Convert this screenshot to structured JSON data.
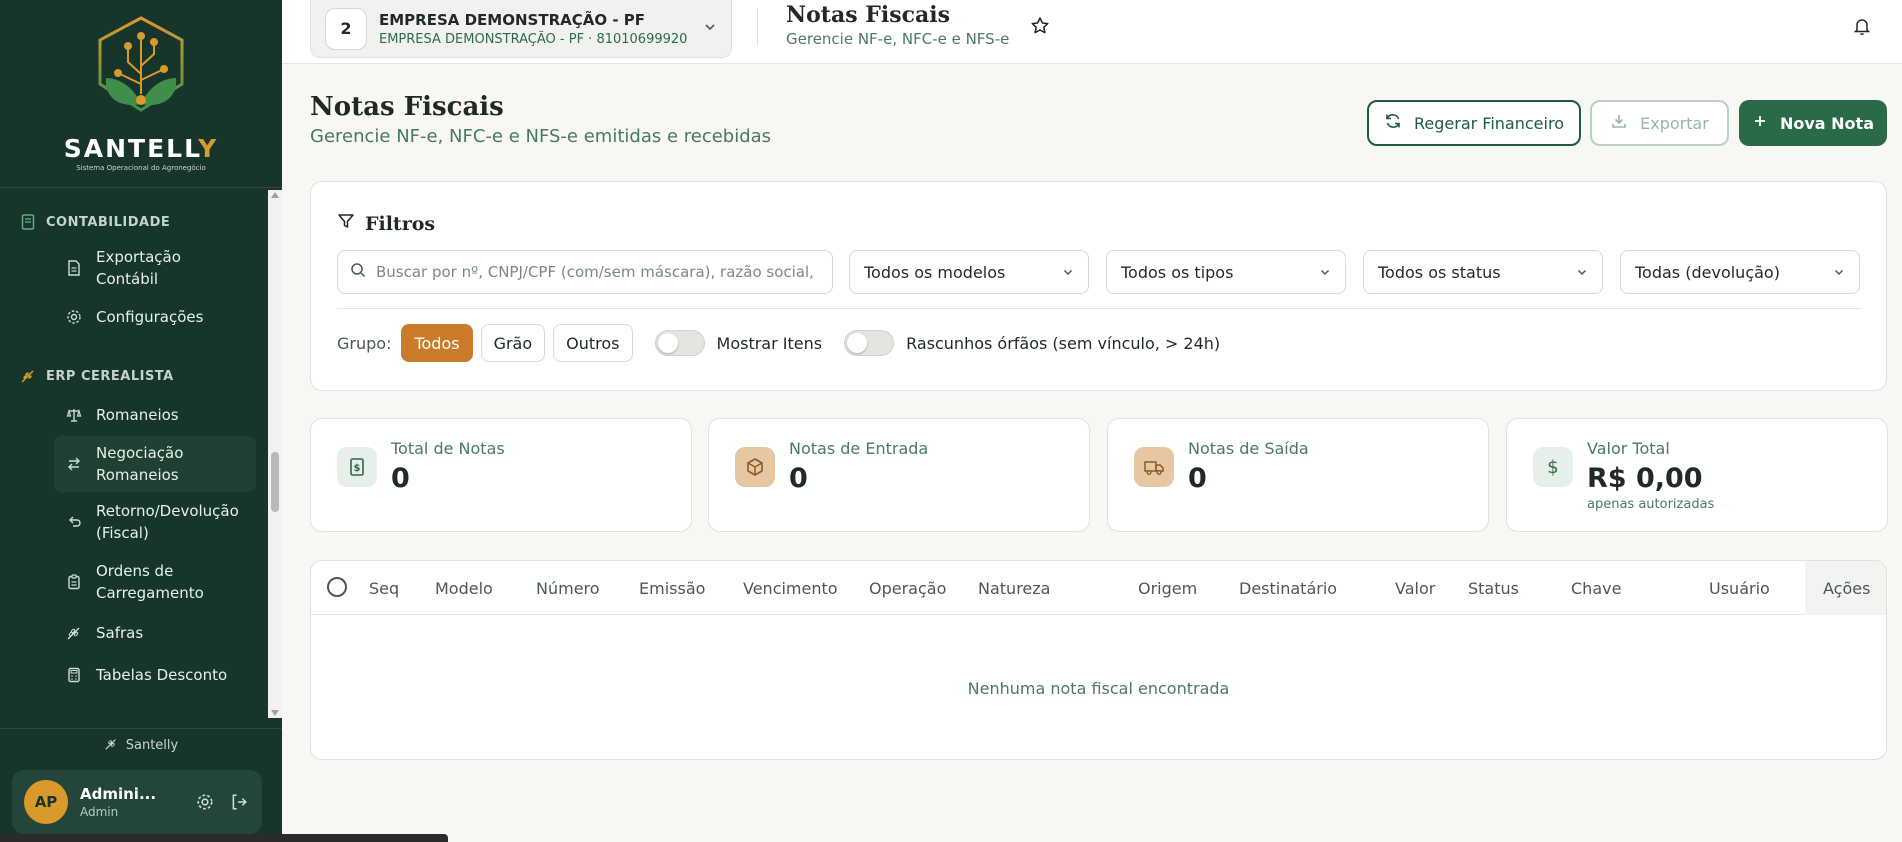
{
  "sidebar": {
    "brand": {
      "name_main": "SANTELL",
      "name_accent": "Y",
      "subtitle": "Sistema Operacional do Agronegócio"
    },
    "sections": [
      {
        "title": "CONTABILIDADE",
        "icon": "ledger-icon",
        "items": [
          {
            "label": "Exportação Contábil",
            "icon": "file-export-icon"
          },
          {
            "label": "Configurações",
            "icon": "gear-icon"
          }
        ]
      },
      {
        "title": "ERP CEREALISTA",
        "icon": "wheat-icon",
        "items": [
          {
            "label": "Romaneios",
            "icon": "scale-icon"
          },
          {
            "label": "Negociação Romaneios",
            "icon": "swap-icon",
            "active": true
          },
          {
            "label": "Retorno/Devolução (Fiscal)",
            "icon": "return-icon"
          },
          {
            "label": "Ordens de Carregamento",
            "icon": "clipboard-icon"
          },
          {
            "label": "Safras",
            "icon": "wheat-icon"
          },
          {
            "label": "Tabelas Desconto",
            "icon": "calculator-icon"
          }
        ]
      }
    ],
    "footer_label": "Santelly",
    "user": {
      "initials": "AP",
      "name": "Admini...",
      "role": "Admin"
    }
  },
  "topbar": {
    "company": {
      "code": "2",
      "name": "EMPRESA DEMONSTRAÇÃO - PF",
      "detail": "EMPRESA DEMONSTRAÇÃO - PF · 81010699920"
    },
    "title": "Notas Fiscais",
    "subtitle": "Gerencie NF-e, NFC-e e NFS-e"
  },
  "page": {
    "title": "Notas Fiscais",
    "subtitle": "Gerencie NF-e, NFC-e e NFS-e emitidas e recebidas",
    "buttons": {
      "regerar": "Regerar Financeiro",
      "exportar": "Exportar",
      "nova": "Nova Nota"
    }
  },
  "filters": {
    "title": "Filtros",
    "search_placeholder": "Buscar por nº, CNPJ/CPF (com/sem máscara), razão social, n",
    "selects": [
      "Todos os modelos",
      "Todos os tipos",
      "Todos os status",
      "Todas (devolução)"
    ],
    "group_label": "Grupo:",
    "groups": [
      "Todos",
      "Grão",
      "Outros"
    ],
    "active_group": "Todos",
    "toggles": [
      "Mostrar Itens",
      "Rascunhos órfãos (sem vínculo, > 24h)"
    ]
  },
  "stats": [
    {
      "label": "Total de Notas",
      "value": "0",
      "icon": "receipt-dollar-icon",
      "icon_bg": "#e6efe9",
      "icon_color": "#2b6a47"
    },
    {
      "label": "Notas de Entrada",
      "value": "0",
      "icon": "package-icon",
      "icon_bg": "#e7c7a2",
      "icon_color": "#8a5a24"
    },
    {
      "label": "Notas de Saída",
      "value": "0",
      "icon": "truck-icon",
      "icon_bg": "#e7c7a2",
      "icon_color": "#8a5a24"
    },
    {
      "label": "Valor Total",
      "value": "R$ 0,00",
      "sub": "apenas autorizadas",
      "icon": "dollar-icon",
      "icon_bg": "#e6efe9",
      "icon_color": "#2b6a47"
    }
  ],
  "table": {
    "columns": [
      "Seq",
      "Modelo",
      "Número",
      "Emissão",
      "Vencimento",
      "Operação",
      "Natureza",
      "Origem",
      "Destinatário",
      "Valor",
      "Status",
      "Chave",
      "Usuário",
      "Ações"
    ],
    "empty": "Nenhuma nota fiscal encontrada"
  },
  "colors": {
    "sidebar": "#17352a",
    "primary": "#2b6a47",
    "accent": "#c97a2a"
  }
}
